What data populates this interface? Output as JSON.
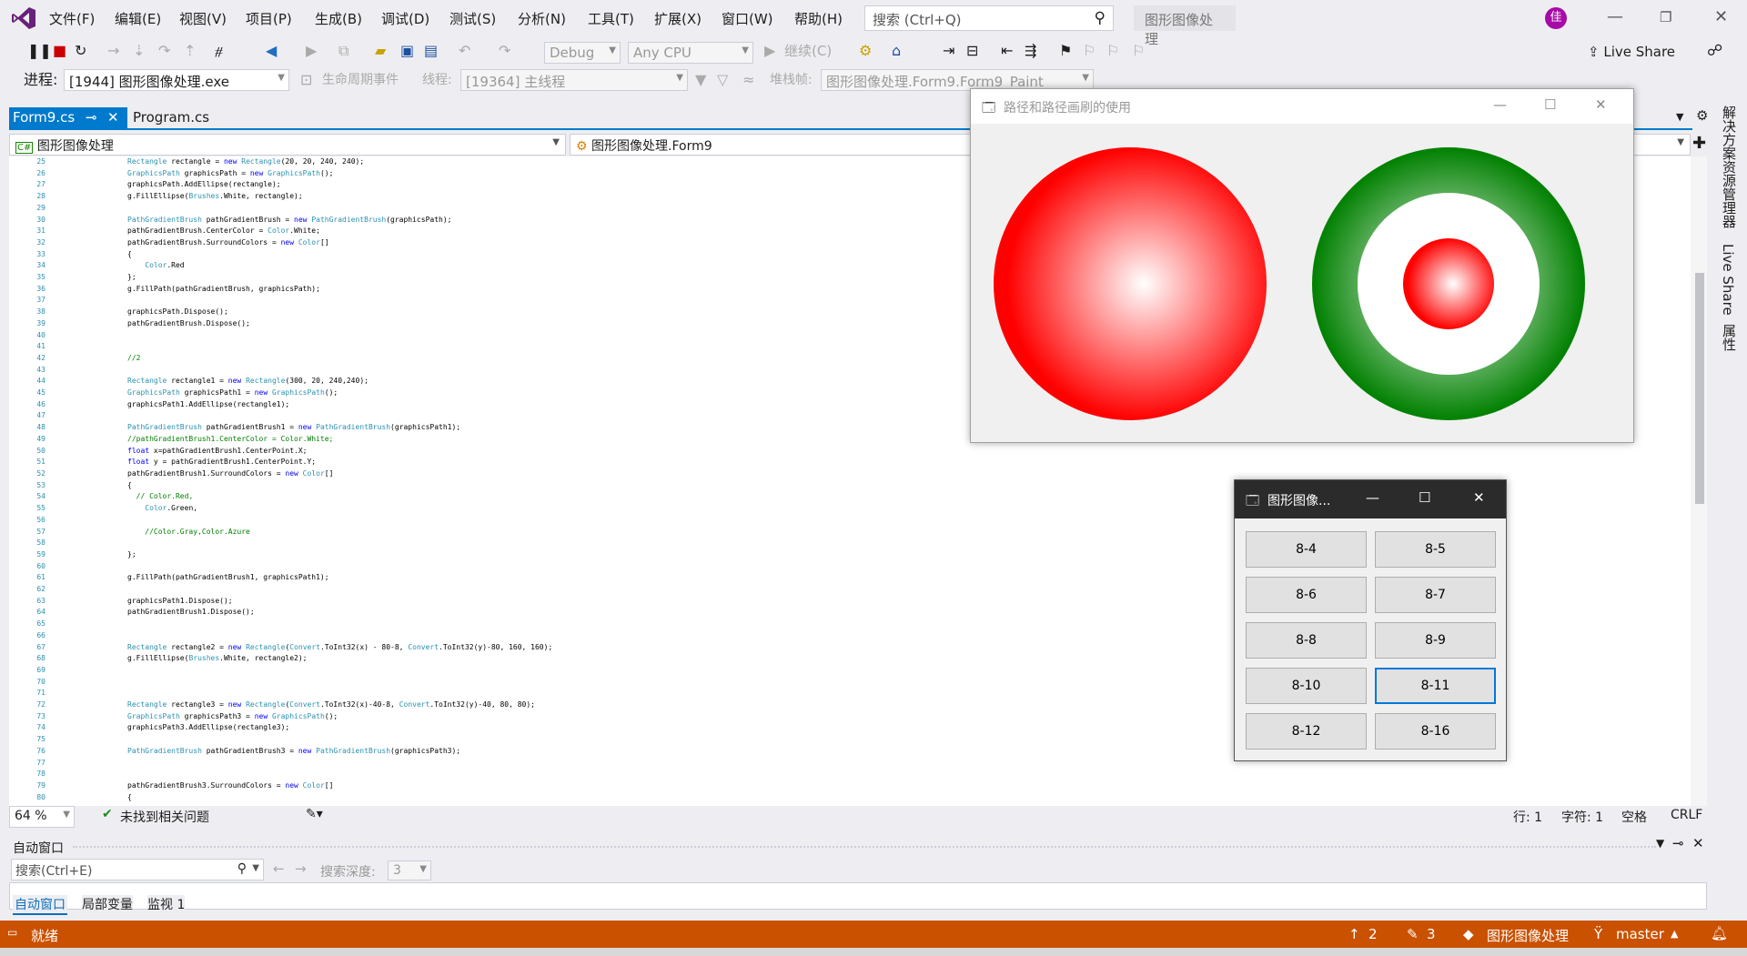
{
  "menu": [
    "文件(F)",
    "编辑(E)",
    "视图(V)",
    "项目(P)",
    "生成(B)",
    "调试(D)",
    "测试(S)",
    "分析(N)",
    "工具(T)",
    "扩展(X)",
    "窗口(W)",
    "帮助(H)"
  ],
  "search": {
    "placeholder": "搜索 (Ctrl+Q)"
  },
  "app_title": "图形图像处理",
  "avatar": "佳",
  "toolbar": {
    "config": "Debug",
    "platform": "Any CPU",
    "continue": "继续(C)",
    "live_share": "Live Share"
  },
  "toolbar2": {
    "process_label": "进程:",
    "process": "[1944] 图形图像处理.exe",
    "lifecycle": "生命周期事件",
    "thread_label": "线程:",
    "thread": "[19364] 主线程",
    "stack_label": "堆栈帧:",
    "stack": "图形图像处理.Form9.Form9_Paint"
  },
  "tabs": [
    {
      "label": "Form9.cs",
      "pin": "⊸",
      "close": "✕"
    },
    {
      "label": "Program.cs"
    }
  ],
  "nav": {
    "project": "图形图像处理",
    "project_badge": "C#",
    "class": "图形图像处理.Form9"
  },
  "gutter": [
    "25",
    "26",
    "27",
    "28",
    "29",
    "30",
    "31",
    "32",
    "33",
    "34",
    "35",
    "36",
    "37",
    "38",
    "39",
    "40",
    "41",
    "42",
    "43",
    "44",
    "45",
    "46",
    "47",
    "48",
    "49",
    "50",
    "51",
    "52",
    "53",
    "54",
    "55",
    "56",
    "57",
    "58",
    "59",
    "60",
    "61",
    "62",
    "63",
    "64",
    "65",
    "66",
    "67",
    "68",
    "69",
    "70",
    "71",
    "72",
    "73",
    "74",
    "75",
    "76",
    "77",
    "78",
    "79",
    "80"
  ],
  "editor_status": {
    "zoom": "64 %",
    "issues": "未找到相关问题",
    "line": "行: 1",
    "char": "字符: 1",
    "spaces": "空格",
    "eol": "CRLF"
  },
  "auto_window": {
    "title": "自动窗口",
    "search_placeholder": "搜索(Ctrl+E)",
    "depth_label": "搜索深度:",
    "depth": "3",
    "tabs": [
      "自动窗口",
      "局部变量",
      "监视 1"
    ]
  },
  "status": {
    "ready": "就绪",
    "up": "2",
    "edits": "3",
    "repo": "图形图像处理",
    "branch": "master"
  },
  "side": [
    "解决方案资源管理器",
    "Live Share",
    "属性"
  ],
  "form1": {
    "title": "路径和路径画刷的使用"
  },
  "form2": {
    "title": "图形图像...",
    "buttons": [
      "8-4",
      "8-5",
      "8-6",
      "8-7",
      "8-8",
      "8-9",
      "8-10",
      "8-11",
      "8-12",
      "8-16"
    ]
  },
  "colors": {
    "accent": "#007acc",
    "status": "#ca5100",
    "red": "#ff0000",
    "green": "#008000"
  }
}
